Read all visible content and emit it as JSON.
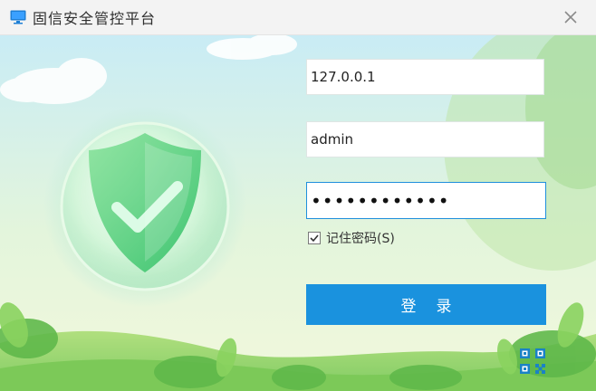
{
  "window": {
    "title": "固信安全管控平台",
    "app_icon": "monitor-icon",
    "close_icon": "close-icon"
  },
  "login": {
    "server_value": "127.0.0.1",
    "username_value": "admin",
    "password_value": "••••••••••••",
    "remember_label": "记住密码(S)",
    "remember_checked": true,
    "login_label": "登录",
    "qr_icon": "qr-code-icon"
  },
  "colors": {
    "accent": "#1a92de",
    "focus_border": "#1f8fdc",
    "background_sky": "#cfeef0",
    "shield_green": "#59d17d"
  }
}
